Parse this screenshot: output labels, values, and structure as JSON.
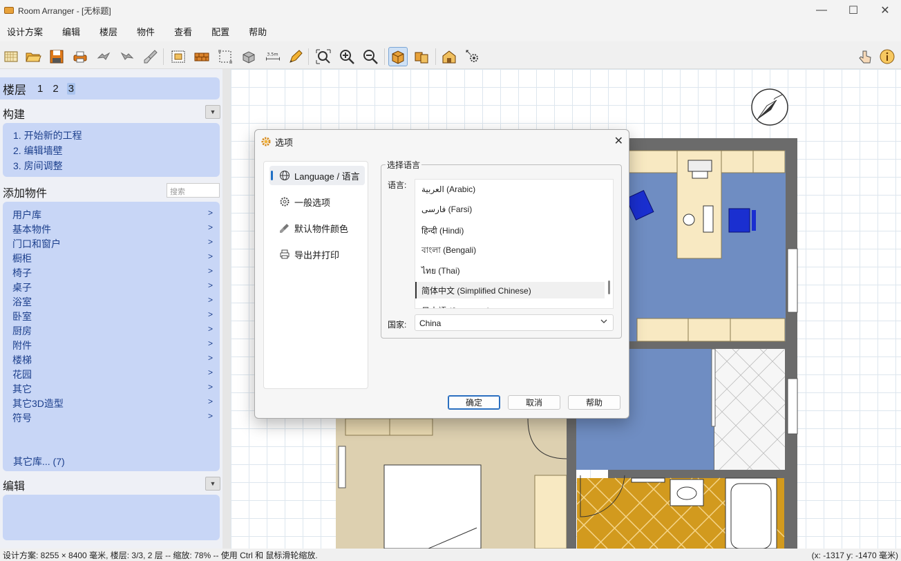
{
  "window": {
    "title": "Room Arranger - [无标题]",
    "minimize_label": "—",
    "maximize_label": "☐",
    "close_label": "✕"
  },
  "menu": [
    "设计方案",
    "编辑",
    "楼层",
    "物件",
    "查看",
    "配置",
    "帮助"
  ],
  "toolbar": {
    "measure_label": "3.5m",
    "active_tool": "3d-box-view"
  },
  "floors": {
    "label": "楼层",
    "items": [
      "1",
      "2",
      "3"
    ],
    "selected": "3"
  },
  "build": {
    "title": "构建",
    "collapse_label": "▼",
    "steps": [
      "1. 开始新的工程",
      "2. 编辑墙壁",
      "3. 房间调整"
    ]
  },
  "add_objects": {
    "title": "添加物件",
    "search_placeholder": "搜索",
    "arrow": ">",
    "categories": [
      "用户库",
      "基本物件",
      "门口和窗户",
      "橱柜",
      "椅子",
      "桌子",
      "浴室",
      "卧室",
      "厨房",
      "附件",
      "楼梯",
      "花园",
      "其它",
      "其它3D造型",
      "符号"
    ],
    "more_libraries": "其它库... (7)"
  },
  "edit": {
    "title": "编辑",
    "collapse_label": "▼"
  },
  "dialog": {
    "title": "选项",
    "close_label": "✕",
    "nav": [
      "Language / 语言",
      "一般选项",
      "默认物件颜色",
      "导出并打印"
    ],
    "selected_nav": "Language / 语言",
    "group_title": "选择语言",
    "language_label": "语言:",
    "languages": [
      "العربية (Arabic)",
      "فارسی (Farsi)",
      "हिन्दी (Hindi)",
      "বাংলা (Bengali)",
      "ไทย (Thai)",
      "简体中文 (Simplified Chinese)",
      "日本語 (Japanese)"
    ],
    "selected_language": "简体中文 (Simplified Chinese)",
    "country_label": "国家:",
    "country_value": "China",
    "buttons": {
      "ok": "确定",
      "cancel": "取消",
      "help": "帮助"
    }
  },
  "status": {
    "left": "设计方案: 8255 × 8400 毫米, 楼层: 3/3, 2 层 -- 缩放: 78% -- 使用 Ctrl 和 鼠标滑轮缩放.",
    "right": "(x: -1317 y: -1470 毫米)"
  },
  "colors": {
    "panel": "#c8d6f6",
    "link": "#1c3f8c",
    "wall": "#6b6b6b",
    "carpet": "#6f8dc2",
    "tile": "#d29a1e",
    "furniture": "#f8e9c2",
    "chair": "#1a2fd0"
  }
}
